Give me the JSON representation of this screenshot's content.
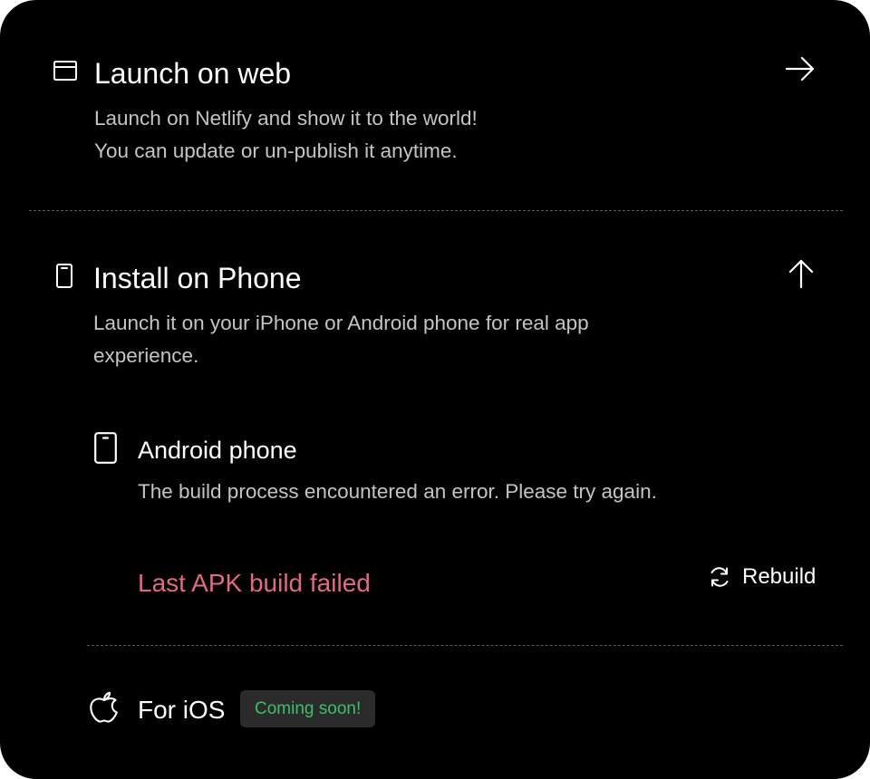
{
  "web": {
    "title": "Launch on web",
    "description_line1": "Launch on Netlify and show it to the world!",
    "description_line2": "You can update or un-publish it anytime.",
    "icon": "browser-window-icon",
    "action_icon": "arrow-right-icon"
  },
  "phone": {
    "title": "Install on Phone",
    "description_line1": "Launch it on your iPhone or Android phone for real app",
    "description_line2": "experience.",
    "icon": "phone-icon",
    "action_icon": "arrow-up-icon",
    "android": {
      "title": "Android phone",
      "description": "The build process encountered an error. Please try again.",
      "status": "Last APK build failed",
      "rebuild_label": "Rebuild",
      "status_color": "#e06a80"
    },
    "ios": {
      "title": "For iOS",
      "badge": "Coming soon!",
      "badge_color": "#3fbf6a"
    }
  }
}
